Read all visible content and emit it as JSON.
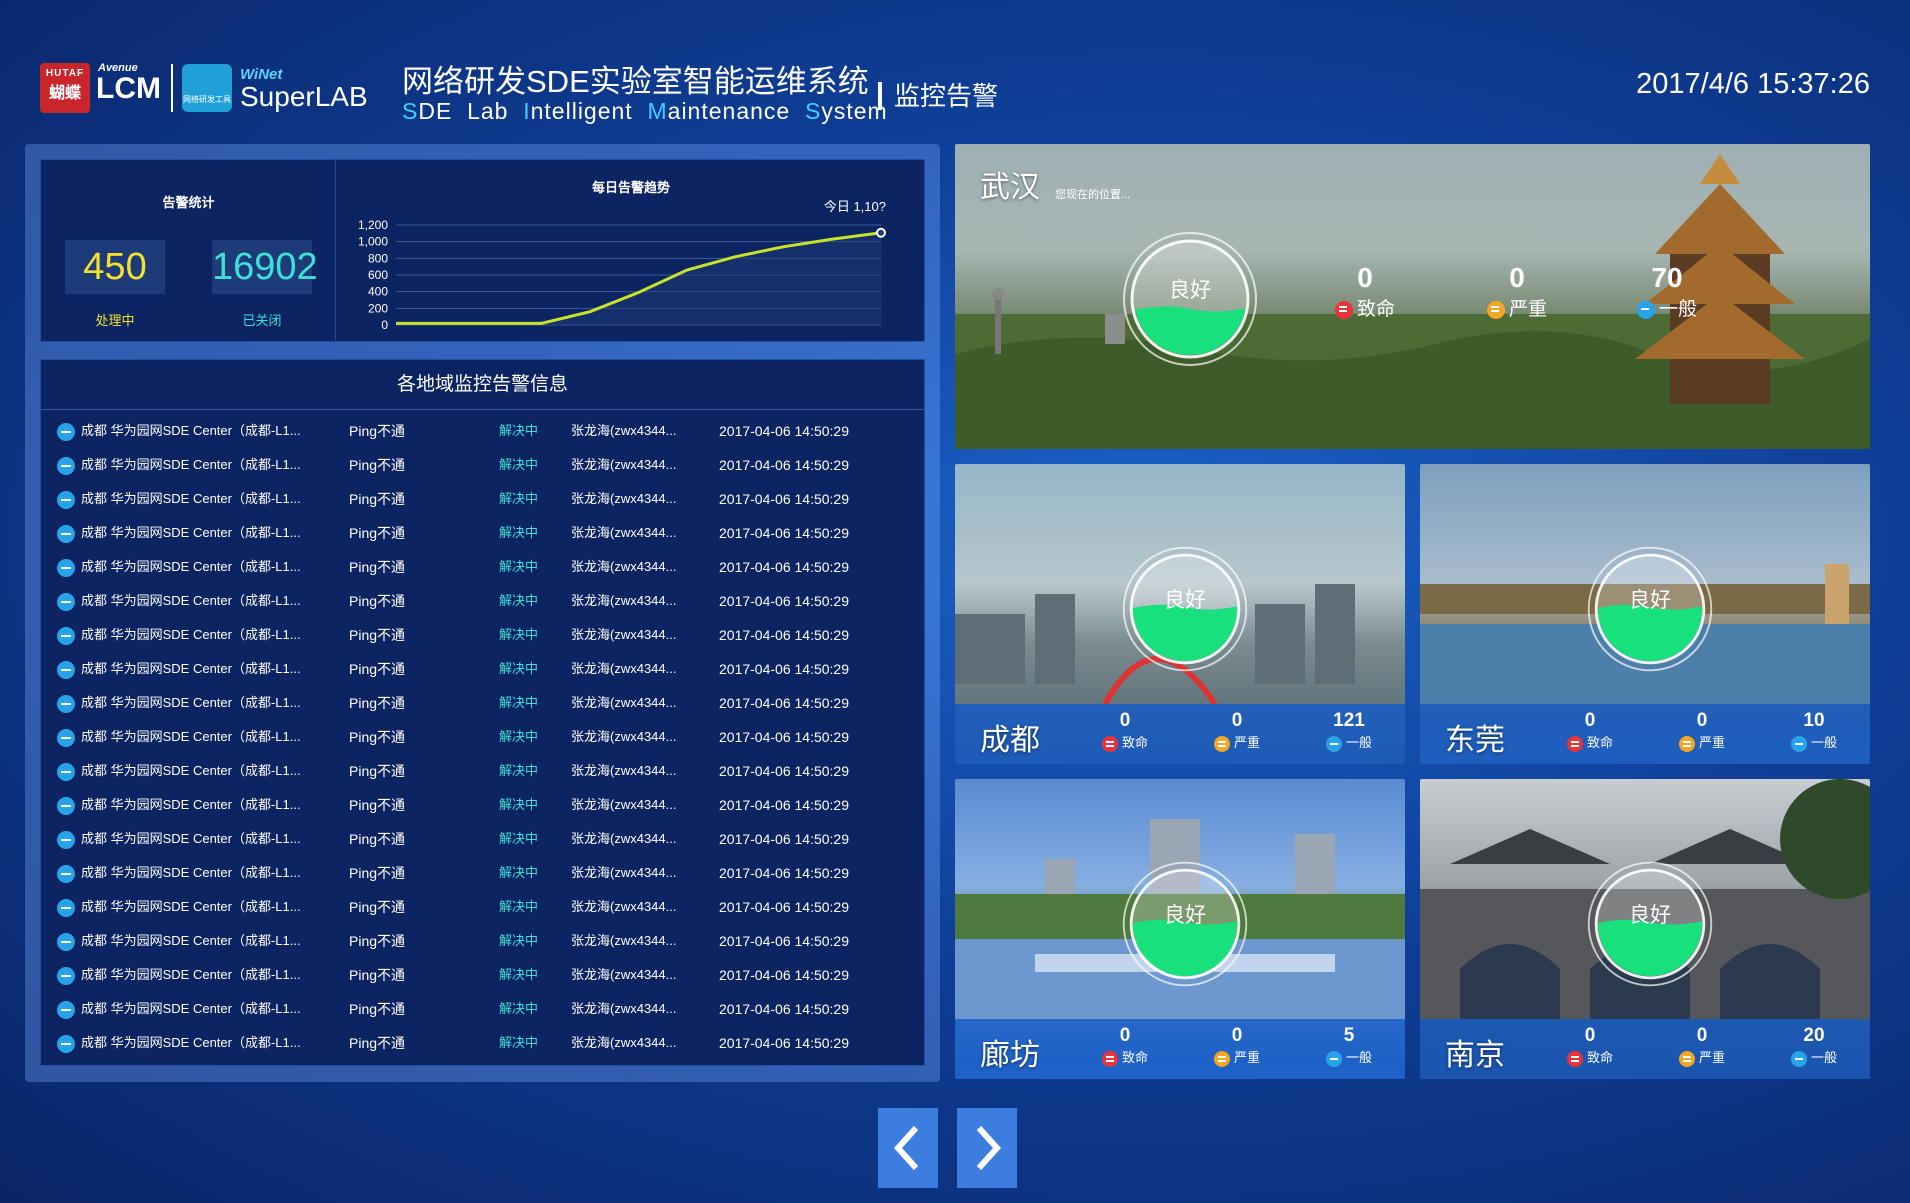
{
  "header": {
    "logo_hutaf_top": "HUTAF",
    "logo_hutaf_bottom": "蝴蝶",
    "logo_avenue": "Avenue",
    "logo_lcm": "LCM",
    "logo_winet": "WiNet",
    "logo_winet_mark": "网络研发工具",
    "logo_superlab": "SuperLAB",
    "title": "网络研发SDE实验室智能运维系统",
    "subtitle_parts": [
      "S",
      "DE  Lab  ",
      "I",
      "ntelligent  ",
      "M",
      "aintenance  ",
      "S",
      "ystem"
    ],
    "page_name": "监控告警",
    "datetime": "2017/4/6 15:37:26"
  },
  "stats": {
    "title": "告警统计",
    "processing_value": "450",
    "processing_label": "处理中",
    "closed_value": "16902",
    "closed_label": "已关闭"
  },
  "chart_data": {
    "type": "line",
    "title": "每日告警趋势",
    "annotation": "今日 1,10?",
    "x": [
      0,
      1,
      2,
      3,
      4,
      5,
      6,
      7,
      8,
      9,
      10
    ],
    "values": [
      20,
      20,
      20,
      20,
      160,
      390,
      660,
      820,
      940,
      1030,
      1107
    ],
    "yticks": [
      "0",
      "200",
      "400",
      "600",
      "800",
      "1,000",
      "1,200"
    ],
    "ylim": [
      0,
      1200
    ],
    "grid": true,
    "colors": {
      "line": "#c9e22a",
      "marker": "#ffffff"
    }
  },
  "alarm_list": {
    "title": "各地域监控告警信息",
    "rows": [
      {
        "location": "成都 华为园网SDE Center（成都-L1...",
        "type": "Ping不通",
        "status": "解决中",
        "owner": "张龙海(zwx4344...",
        "time": "2017-04-06 14:50:29"
      },
      {
        "location": "成都 华为园网SDE Center（成都-L1...",
        "type": "Ping不通",
        "status": "解决中",
        "owner": "张龙海(zwx4344...",
        "time": "2017-04-06 14:50:29"
      },
      {
        "location": "成都 华为园网SDE Center（成都-L1...",
        "type": "Ping不通",
        "status": "解决中",
        "owner": "张龙海(zwx4344...",
        "time": "2017-04-06 14:50:29"
      },
      {
        "location": "成都 华为园网SDE Center（成都-L1...",
        "type": "Ping不通",
        "status": "解决中",
        "owner": "张龙海(zwx4344...",
        "time": "2017-04-06 14:50:29"
      },
      {
        "location": "成都 华为园网SDE Center（成都-L1...",
        "type": "Ping不通",
        "status": "解决中",
        "owner": "张龙海(zwx4344...",
        "time": "2017-04-06 14:50:29"
      },
      {
        "location": "成都 华为园网SDE Center（成都-L1...",
        "type": "Ping不通",
        "status": "解决中",
        "owner": "张龙海(zwx4344...",
        "time": "2017-04-06 14:50:29"
      },
      {
        "location": "成都 华为园网SDE Center（成都-L1...",
        "type": "Ping不通",
        "status": "解决中",
        "owner": "张龙海(zwx4344...",
        "time": "2017-04-06 14:50:29"
      },
      {
        "location": "成都 华为园网SDE Center（成都-L1...",
        "type": "Ping不通",
        "status": "解决中",
        "owner": "张龙海(zwx4344...",
        "time": "2017-04-06 14:50:29"
      },
      {
        "location": "成都 华为园网SDE Center（成都-L1...",
        "type": "Ping不通",
        "status": "解决中",
        "owner": "张龙海(zwx4344...",
        "time": "2017-04-06 14:50:29"
      },
      {
        "location": "成都 华为园网SDE Center（成都-L1...",
        "type": "Ping不通",
        "status": "解决中",
        "owner": "张龙海(zwx4344...",
        "time": "2017-04-06 14:50:29"
      },
      {
        "location": "成都 华为园网SDE Center（成都-L1...",
        "type": "Ping不通",
        "status": "解决中",
        "owner": "张龙海(zwx4344...",
        "time": "2017-04-06 14:50:29"
      },
      {
        "location": "成都 华为园网SDE Center（成都-L1...",
        "type": "Ping不通",
        "status": "解决中",
        "owner": "张龙海(zwx4344...",
        "time": "2017-04-06 14:50:29"
      },
      {
        "location": "成都 华为园网SDE Center（成都-L1...",
        "type": "Ping不通",
        "status": "解决中",
        "owner": "张龙海(zwx4344...",
        "time": "2017-04-06 14:50:29"
      },
      {
        "location": "成都 华为园网SDE Center（成都-L1...",
        "type": "Ping不通",
        "status": "解决中",
        "owner": "张龙海(zwx4344...",
        "time": "2017-04-06 14:50:29"
      },
      {
        "location": "成都 华为园网SDE Center（成都-L1...",
        "type": "Ping不通",
        "status": "解决中",
        "owner": "张龙海(zwx4344...",
        "time": "2017-04-06 14:50:29"
      },
      {
        "location": "成都 华为园网SDE Center（成都-L1...",
        "type": "Ping不通",
        "status": "解决中",
        "owner": "张龙海(zwx4344...",
        "time": "2017-04-06 14:50:29"
      },
      {
        "location": "成都 华为园网SDE Center（成都-L1...",
        "type": "Ping不通",
        "status": "解决中",
        "owner": "张龙海(zwx4344...",
        "time": "2017-04-06 14:50:29"
      },
      {
        "location": "成都 华为园网SDE Center（成都-L1...",
        "type": "Ping不通",
        "status": "解决中",
        "owner": "张龙海(zwx4344...",
        "time": "2017-04-06 14:50:29"
      },
      {
        "location": "成都 华为园网SDE Center（成都-L1...",
        "type": "Ping不通",
        "status": "解决中",
        "owner": "张龙海(zwx4344...",
        "time": "2017-04-06 14:50:29"
      }
    ]
  },
  "cities": {
    "wuhan": {
      "name": "武汉",
      "hint": "您现在的位置...",
      "health": "良好",
      "fatal": "0",
      "serious": "0",
      "normal": "70"
    },
    "chengdu": {
      "name": "成都",
      "health": "良好",
      "fatal": "0",
      "serious": "0",
      "normal": "121"
    },
    "dongguan": {
      "name": "东莞",
      "health": "良好",
      "fatal": "0",
      "serious": "0",
      "normal": "10"
    },
    "langfang": {
      "name": "廊坊",
      "health": "良好",
      "fatal": "0",
      "serious": "0",
      "normal": "5"
    },
    "nanjing": {
      "name": "南京",
      "health": "良好",
      "fatal": "0",
      "serious": "0",
      "normal": "20"
    }
  },
  "labels": {
    "fatal": "致命",
    "serious": "严重",
    "normal": "一般"
  },
  "nav": {
    "prev_icon": "chevron-left-icon",
    "next_icon": "chevron-right-icon"
  }
}
